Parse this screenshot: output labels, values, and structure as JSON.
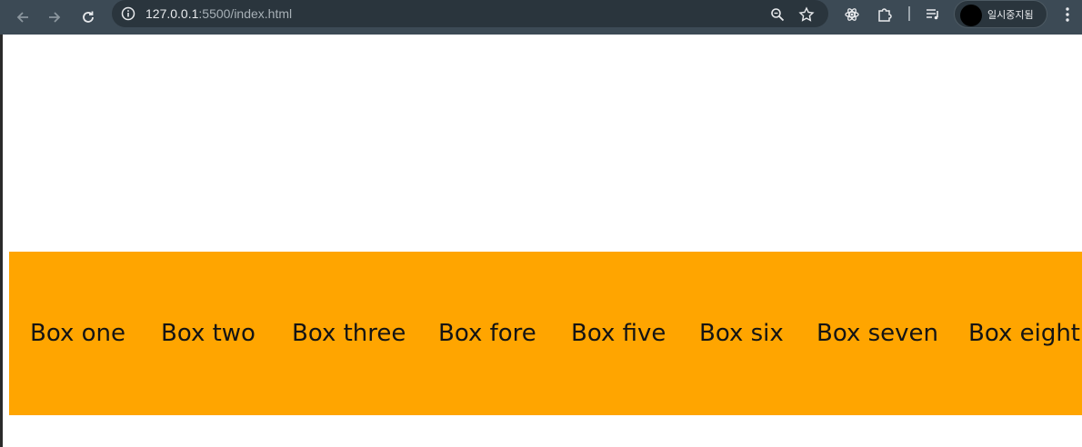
{
  "browser": {
    "url_host": "127.0.0.1",
    "url_rest": ":5500/index.html",
    "profile_label": "일시중지됨"
  },
  "icons": [
    "back-icon",
    "forward-icon",
    "reload-icon",
    "site-info-icon",
    "zoom-icon",
    "bookmark-star-icon",
    "react-devtools-icon",
    "extensions-icon",
    "media-control-icon",
    "avatar",
    "more-menu-icon"
  ],
  "boxes": [
    "Box one",
    "Box two",
    "Box three",
    "Box fore",
    "Box five",
    "Box six",
    "Box seven",
    "Box eight"
  ],
  "colors": {
    "container_bg": "#ffa500",
    "toolbar_bg": "#3c4a55"
  }
}
